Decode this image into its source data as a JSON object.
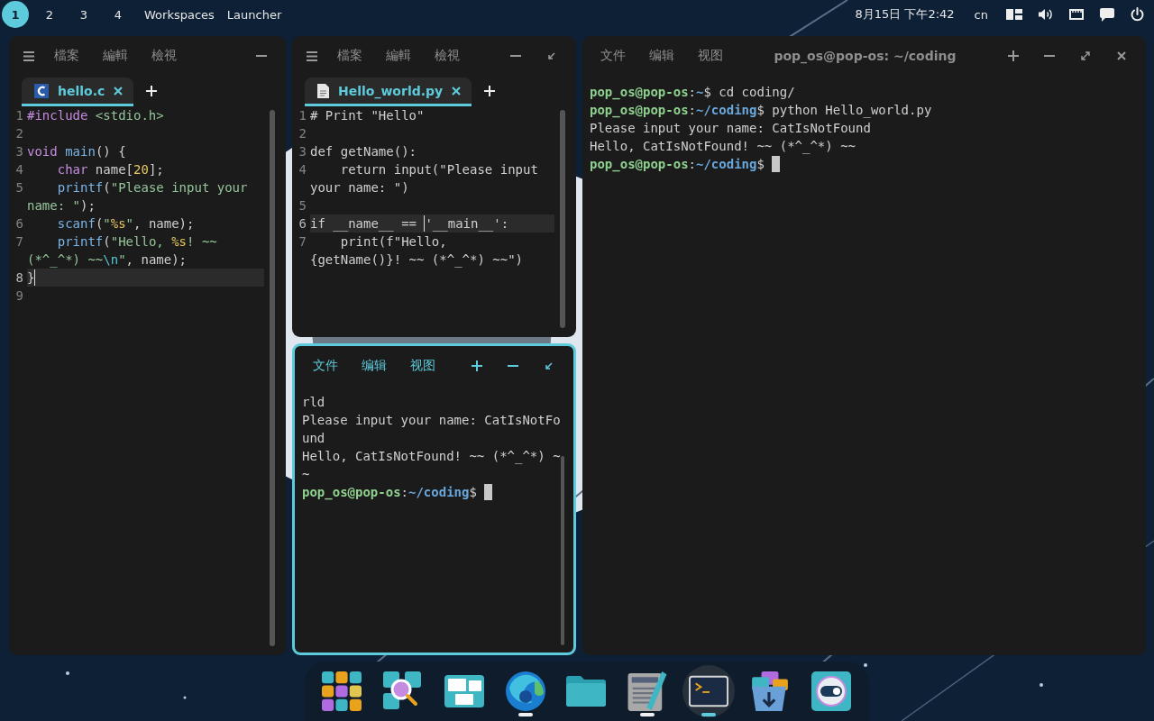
{
  "top_bar": {
    "workspaces": [
      {
        "label": "1",
        "selected": true
      },
      {
        "label": "2",
        "selected": false
      },
      {
        "label": "3",
        "selected": false
      },
      {
        "label": "4",
        "selected": false
      }
    ],
    "buttons": [
      "Workspaces",
      "Launcher"
    ],
    "clock": "8月15日 下午2:42",
    "keyboard": "cn",
    "tray": [
      {
        "kind": "layout"
      },
      {
        "kind": "volume"
      },
      {
        "kind": "network"
      },
      {
        "kind": "notifications"
      },
      {
        "kind": "power"
      }
    ]
  },
  "columns": [
    [
      {
        "kind": "editor",
        "focused": false,
        "menu": [
          "檔案",
          "編輯",
          "檢視"
        ],
        "controls": [
          {
            "kind": "minimize"
          }
        ],
        "tabs": [
          {
            "kind": "c",
            "label": "hello.c",
            "selected": true
          }
        ],
        "lines": [
          {
            "number": "1",
            "current": false,
            "tokens": [
              {
                "kind": "keyword",
                "text": "#include"
              },
              {
                "kind": "string",
                "text": " <stdio.h>"
              }
            ]
          },
          {
            "number": "2",
            "current": false
          },
          {
            "number": "3",
            "current": false,
            "tokens": [
              {
                "kind": "keyword",
                "text": "void"
              },
              {
                "kind": "function",
                "text": " main"
              },
              {
                "kind": "plain",
                "text": "() {"
              }
            ]
          },
          {
            "number": "4",
            "current": false,
            "tokens": [
              {
                "kind": "keyword",
                "text": "    char"
              },
              {
                "kind": "plain",
                "text": " name["
              },
              {
                "kind": "number",
                "text": "20"
              },
              {
                "kind": "plain",
                "text": "];"
              }
            ]
          },
          {
            "number": "5",
            "current": false,
            "tokens": [
              {
                "kind": "function",
                "text": "    printf"
              },
              {
                "kind": "plain",
                "text": "("
              },
              {
                "kind": "string",
                "text": "\"Please input your name: \""
              },
              {
                "kind": "plain",
                "text": ");"
              }
            ]
          },
          {
            "number": "6",
            "current": false,
            "tokens": [
              {
                "kind": "function",
                "text": "    scanf"
              },
              {
                "kind": "plain",
                "text": "("
              },
              {
                "kind": "string",
                "text": "\""
              },
              {
                "kind": "number",
                "text": "%s"
              },
              {
                "kind": "string",
                "text": "\""
              },
              {
                "kind": "plain",
                "text": ", name);"
              }
            ]
          },
          {
            "number": "7",
            "current": false,
            "tokens": [
              {
                "kind": "function",
                "text": "    printf"
              },
              {
                "kind": "plain",
                "text": "("
              },
              {
                "kind": "string",
                "text": "\"Hello, "
              },
              {
                "kind": "number",
                "text": "%s"
              },
              {
                "kind": "string",
                "text": "! ~~ (*^_^*) ~~"
              },
              {
                "kind": "escape",
                "text": "\\n"
              },
              {
                "kind": "string",
                "text": "\""
              },
              {
                "kind": "plain",
                "text": ", name);"
              }
            ]
          },
          {
            "number": "8",
            "current": true,
            "tokens": [
              {
                "kind": "plain",
                "text": "}"
              },
              {
                "kind": "caret"
              }
            ]
          },
          {
            "number": "9",
            "current": false
          }
        ]
      }
    ],
    [
      {
        "kind": "editor",
        "focused": false,
        "menu": [
          "檔案",
          "編輯",
          "檢視"
        ],
        "controls": [
          {
            "kind": "minimize"
          },
          {
            "kind": "restore"
          }
        ],
        "tabs": [
          {
            "kind": "file",
            "label": "Hello_world.py",
            "selected": true
          }
        ],
        "lines": [
          {
            "number": "1",
            "current": false,
            "tokens": [
              {
                "kind": "plain",
                "text": "# Print \"Hello\""
              }
            ]
          },
          {
            "number": "2",
            "current": false
          },
          {
            "number": "3",
            "current": false,
            "tokens": [
              {
                "kind": "plain",
                "text": "def getName():"
              }
            ]
          },
          {
            "number": "4",
            "current": false,
            "tokens": [
              {
                "kind": "plain",
                "text": "    return input(\"Please input your name: \")"
              }
            ]
          },
          {
            "number": "5",
            "current": false
          },
          {
            "number": "6",
            "current": true,
            "tokens": [
              {
                "kind": "plain",
                "text": "if __name__ == "
              },
              {
                "kind": "caret"
              },
              {
                "kind": "plain",
                "text": "'__main__':"
              }
            ]
          },
          {
            "number": "7",
            "current": false,
            "tokens": [
              {
                "kind": "plain",
                "text": "    print(f\"Hello, {getName()}! ~~ (*^_^*) ~~\")"
              }
            ]
          }
        ]
      },
      {
        "kind": "terminal",
        "focused": true,
        "menu": [
          "文件",
          "编辑",
          "视图"
        ],
        "controls": [
          {
            "kind": "new"
          },
          {
            "kind": "minimize"
          },
          {
            "kind": "restore"
          }
        ],
        "lines": [
          {
            "tokens": [
              {
                "kind": "plain",
                "text": "rld"
              }
            ]
          },
          {
            "tokens": [
              {
                "kind": "plain",
                "text": "Please input your name: CatIsNotFound"
              }
            ]
          },
          {
            "tokens": [
              {
                "kind": "plain",
                "text": "Hello, CatIsNotFound! ~~ (*^_^*) ~~"
              }
            ]
          },
          {
            "tokens": [
              {
                "kind": "user",
                "text": "pop_os@pop-os"
              },
              {
                "kind": "plain",
                "text": ":"
              },
              {
                "kind": "path",
                "text": "~/coding"
              },
              {
                "kind": "plain",
                "text": "$"
              },
              {
                "kind": "cursor"
              }
            ]
          }
        ]
      }
    ],
    [
      {
        "kind": "terminal",
        "focused": false,
        "menu": [
          "文件",
          "编辑",
          "视图"
        ],
        "title": "pop_os@pop-os: ~/coding",
        "controls": [
          {
            "kind": "new"
          },
          {
            "kind": "minimize"
          },
          {
            "kind": "maximize"
          },
          {
            "kind": "close"
          }
        ],
        "lines": [
          {
            "tokens": [
              {
                "kind": "user",
                "text": "pop_os@pop-os"
              },
              {
                "kind": "plain",
                "text": ":"
              },
              {
                "kind": "path",
                "text": "~"
              },
              {
                "kind": "plain",
                "text": "$ cd coding/"
              }
            ]
          },
          {
            "tokens": [
              {
                "kind": "user",
                "text": "pop_os@pop-os"
              },
              {
                "kind": "plain",
                "text": ":"
              },
              {
                "kind": "path",
                "text": "~/coding"
              },
              {
                "kind": "plain",
                "text": "$ python Hello_world.py"
              }
            ]
          },
          {
            "tokens": [
              {
                "kind": "plain",
                "text": "Please input your name: CatIsNotFound"
              }
            ]
          },
          {
            "tokens": [
              {
                "kind": "plain",
                "text": "Hello, CatIsNotFound! ~~ (*^_^*) ~~"
              }
            ]
          },
          {
            "tokens": [
              {
                "kind": "user",
                "text": "pop_os@pop-os"
              },
              {
                "kind": "plain",
                "text": ":"
              },
              {
                "kind": "path",
                "text": "~/coding"
              },
              {
                "kind": "plain",
                "text": "$"
              },
              {
                "kind": "cursor"
              }
            ]
          }
        ]
      }
    ]
  ],
  "dock": [
    {
      "kind": "apps",
      "running": false,
      "selected": false
    },
    {
      "kind": "search",
      "running": false,
      "selected": false
    },
    {
      "kind": "workspaces",
      "running": false,
      "selected": false
    },
    {
      "kind": "browser",
      "running": true,
      "selected": false
    },
    {
      "kind": "files",
      "running": false,
      "selected": false
    },
    {
      "kind": "editor",
      "running": true,
      "selected": false
    },
    {
      "kind": "terminal",
      "running": true,
      "selected": true
    },
    {
      "kind": "store",
      "running": false,
      "selected": false
    },
    {
      "kind": "settings",
      "running": false,
      "selected": false
    }
  ]
}
